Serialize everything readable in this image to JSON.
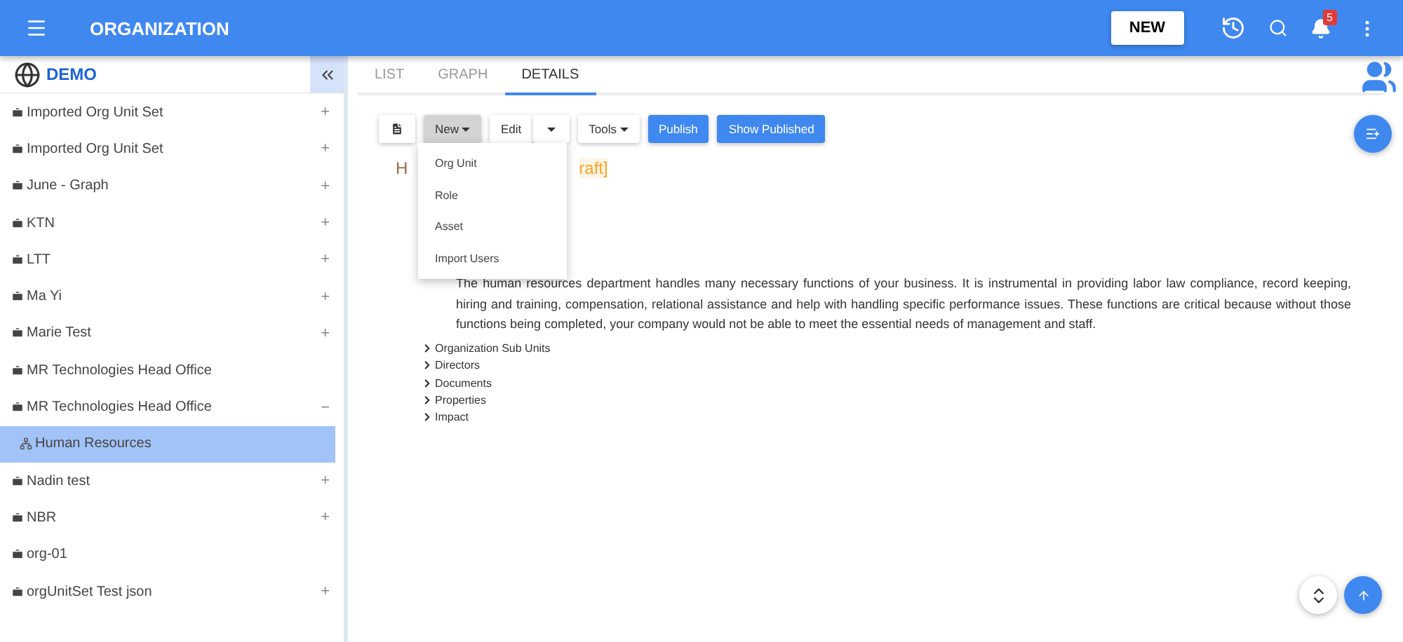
{
  "app_bar": {
    "title": "ORGANIZATION",
    "new_button": "NEW",
    "notification_count": "5"
  },
  "sidebar": {
    "title": "DEMO",
    "items": [
      {
        "label": "Imported Org Unit Set",
        "toggle": "+",
        "selected": false
      },
      {
        "label": "Imported Org Unit Set",
        "toggle": "+",
        "selected": false
      },
      {
        "label": "June - Graph",
        "toggle": "+",
        "selected": false
      },
      {
        "label": "KTN",
        "toggle": "+",
        "selected": false
      },
      {
        "label": "LTT",
        "toggle": "+",
        "selected": false
      },
      {
        "label": "Ma Yi",
        "toggle": "+",
        "selected": false
      },
      {
        "label": "Marie Test",
        "toggle": "+",
        "selected": false
      },
      {
        "label": "MR Technologies Head Office",
        "selected": false
      },
      {
        "label": "MR Technologies Head Office",
        "toggle": "−",
        "selected": false,
        "children": [
          {
            "label": "Human Resources",
            "selected": true
          }
        ]
      },
      {
        "label": "Nadin test",
        "toggle": "+",
        "selected": false
      },
      {
        "label": "NBR",
        "toggle": "+",
        "selected": false
      },
      {
        "label": "org-01",
        "selected": false
      },
      {
        "label": "orgUnitSet Test json",
        "toggle": "+",
        "selected": false
      }
    ]
  },
  "tabs": [
    {
      "label": "LIST",
      "selected": false
    },
    {
      "label": "GRAPH",
      "selected": false
    },
    {
      "label": "DETAILS",
      "selected": true
    }
  ],
  "toolbar": {
    "new": "New",
    "edit": "Edit",
    "tools": "Tools",
    "publish": "Publish",
    "show_published": "Show Published"
  },
  "new_menu": {
    "items": [
      "Org Unit",
      "Role",
      "Asset",
      "Import Users"
    ]
  },
  "details": {
    "heading_visible": "H",
    "draft_visible": "raft]",
    "description": "The human resources department handles many necessary functions of your business. It is instrumental in providing labor law compliance, record keeping, hiring and training, compensation, relational assistance and help with handling specific performance issues. These functions are critical because without those functions being completed, your company would not be able to meet the essential needs of management and staff.",
    "sections": [
      "Organization Sub Units",
      "Directors",
      "Documents",
      "Properties",
      "Impact"
    ]
  }
}
